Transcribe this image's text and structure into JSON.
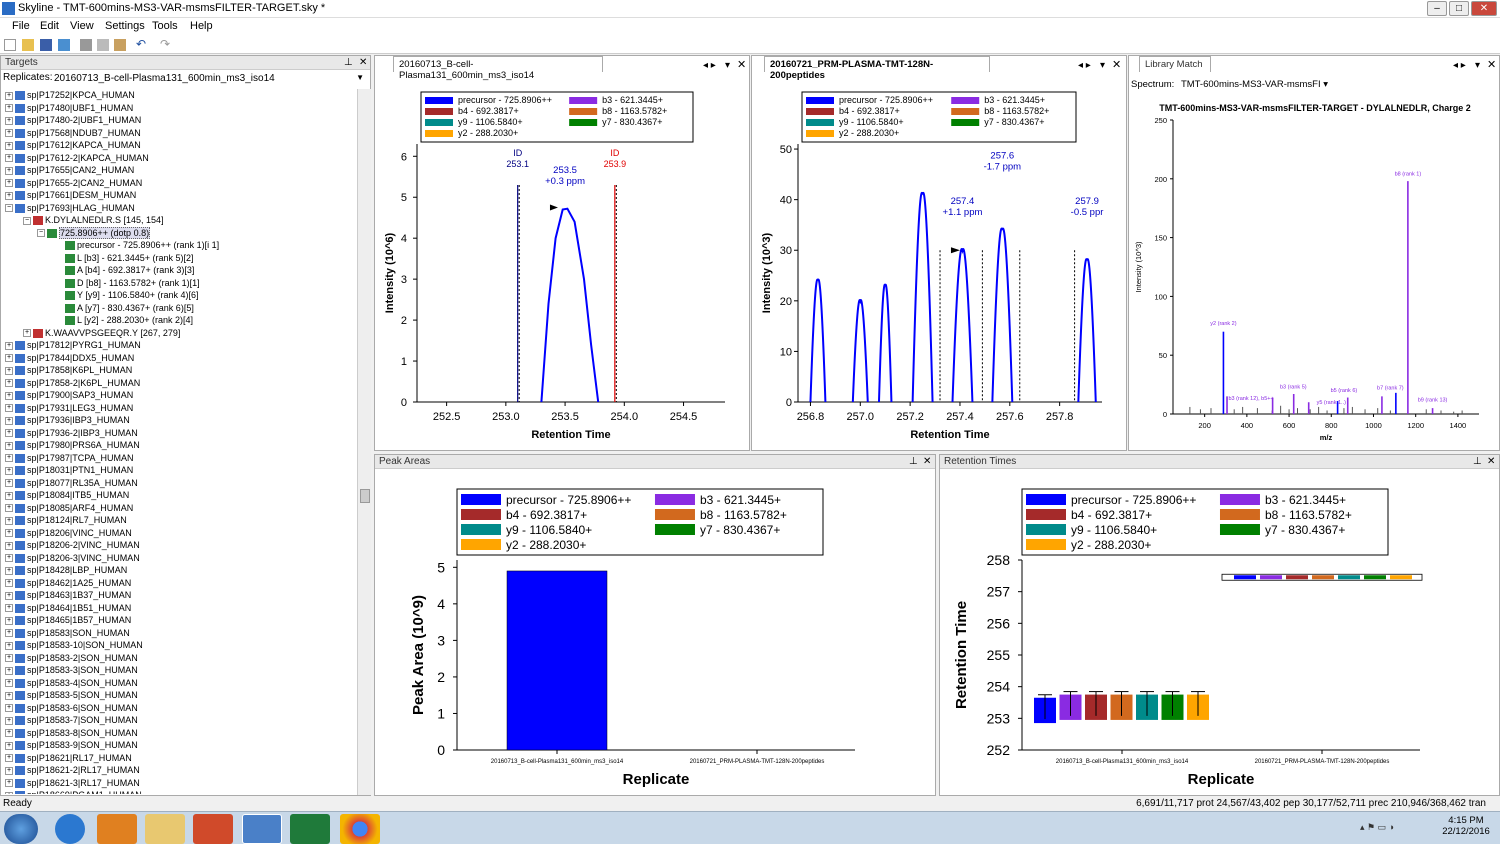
{
  "window": {
    "title": "Skyline - TMT-600mins-MS3-VAR-msmsFILTER-TARGET.sky *"
  },
  "menu": [
    "File",
    "Edit",
    "View",
    "Settings",
    "Tools",
    "Help"
  ],
  "targets": {
    "title": "Targets",
    "replicates_label": "Replicates:",
    "replicate_value": "20160713_B-cell-Plasma131_600min_ms3_iso14",
    "proteins_top": [
      "sp|P17252|KPCA_HUMAN",
      "sp|P17480|UBF1_HUMAN",
      "sp|P17480-2|UBF1_HUMAN",
      "sp|P17568|NDUB7_HUMAN",
      "sp|P17612|KAPCA_HUMAN",
      "sp|P17612-2|KAPCA_HUMAN",
      "sp|P17655|CAN2_HUMAN",
      "sp|P17655-2|CAN2_HUMAN",
      "sp|P17661|DESM_HUMAN",
      "sp|P17693|HLAG_HUMAN"
    ],
    "peptide1": "K.DYLALNEDLR.S [145, 154]",
    "precursor": "725.8906++ (dotp 0.8)",
    "transitions": [
      "precursor - 725.8906++ (rank 1)[i 1]",
      "L [b3] - 621.3445+ (rank 5)[2]",
      "A [b4] - 692.3817+ (rank 3)[3]",
      "D [b8] - 1163.5782+ (rank 1)[1]",
      "Y [y9] - 1106.5840+ (rank 4)[6]",
      "A [y7] - 830.4367+ (rank 6)[5]",
      "L [y2] - 288.2030+ (rank 2)[4]"
    ],
    "peptide2": "K.WAAVVPSGEEQR.Y [267, 279]",
    "proteins_bottom": [
      "sp|P17812|PYRG1_HUMAN",
      "sp|P17844|DDX5_HUMAN",
      "sp|P17858|K6PL_HUMAN",
      "sp|P17858-2|K6PL_HUMAN",
      "sp|P17900|SAP3_HUMAN",
      "sp|P17931|LEG3_HUMAN",
      "sp|P17936|IBP3_HUMAN",
      "sp|P17936-2|IBP3_HUMAN",
      "sp|P17980|PRS6A_HUMAN",
      "sp|P17987|TCPA_HUMAN",
      "sp|P18031|PTN1_HUMAN",
      "sp|P18077|RL35A_HUMAN",
      "sp|P18084|ITB5_HUMAN",
      "sp|P18085|ARF4_HUMAN",
      "sp|P18124|RL7_HUMAN",
      "sp|P18206|VINC_HUMAN",
      "sp|P18206-2|VINC_HUMAN",
      "sp|P18206-3|VINC_HUMAN",
      "sp|P18428|LBP_HUMAN",
      "sp|P18462|1A25_HUMAN",
      "sp|P18463|1B37_HUMAN",
      "sp|P18464|1B51_HUMAN",
      "sp|P18465|1B57_HUMAN",
      "sp|P18583|SON_HUMAN",
      "sp|P18583-10|SON_HUMAN",
      "sp|P18583-2|SON_HUMAN",
      "sp|P18583-3|SON_HUMAN",
      "sp|P18583-4|SON_HUMAN",
      "sp|P18583-5|SON_HUMAN",
      "sp|P18583-6|SON_HUMAN",
      "sp|P18583-7|SON_HUMAN",
      "sp|P18583-8|SON_HUMAN",
      "sp|P18583-9|SON_HUMAN",
      "sp|P18621|RL17_HUMAN",
      "sp|P18621-2|RL17_HUMAN",
      "sp|P18621-3|RL17_HUMAN",
      "sp|P18669|PGAM1_HUMAN"
    ]
  },
  "colors": {
    "precursor": "#0000ff",
    "b3": "#8a2be2",
    "b4": "#a52a2a",
    "b8": "#d2691e",
    "y9": "#008b8b",
    "y7": "#008000",
    "y2": "#ffa500"
  },
  "legend": [
    {
      "key": "precursor",
      "label": "precursor - 725.8906++"
    },
    {
      "key": "b3",
      "label": "b3 - 621.3445+"
    },
    {
      "key": "b4",
      "label": "b4 - 692.3817+"
    },
    {
      "key": "b8",
      "label": "b8 - 1163.5782+"
    },
    {
      "key": "y9",
      "label": "y9 - 1106.5840+"
    },
    {
      "key": "y7",
      "label": "y7 - 830.4367+"
    },
    {
      "key": "y2",
      "label": "y2 - 288.2030+"
    }
  ],
  "chrom1": {
    "tab": "20160713_B-cell-Plasma131_600min_ms3_iso14",
    "ylabel": "Intensity (10^6)",
    "xlabel": "Retention Time",
    "yticks": [
      "0",
      "1",
      "2",
      "3",
      "4",
      "5",
      "6"
    ],
    "xticks": [
      "252.5",
      "253.0",
      "253.5",
      "254.0",
      "254.5"
    ],
    "id_left": {
      "label": "ID",
      "value": "253.1"
    },
    "id_right": {
      "label": "ID",
      "value": "253.9"
    },
    "peak": {
      "rt": "253.5",
      "ppm": "+0.3 ppm"
    }
  },
  "chrom2": {
    "tab": "20160721_PRM-PLASMA-TMT-128N-200peptides",
    "ylabel": "Intensity (10^3)",
    "xlabel": "Retention Time",
    "yticks": [
      "0",
      "10",
      "20",
      "30",
      "40",
      "50"
    ],
    "xticks": [
      "256.8",
      "257.0",
      "257.2",
      "257.4",
      "257.6",
      "257.8"
    ],
    "peaks": [
      {
        "rt": "257.4",
        "ppm": "+1.1 ppm"
      },
      {
        "rt": "257.6",
        "ppm": "-1.7 ppm"
      },
      {
        "rt": "257.9",
        "ppm": "-0.5 ppr"
      }
    ]
  },
  "library": {
    "tab": "Library Match",
    "spectrum_label": "Spectrum:",
    "spectrum_value": "TMT-600mins-MS3-VAR-msmsFI",
    "title": "TMT-600mins-MS3-VAR-msmsFILTER-TARGET - DYLALNEDLR, Charge 2",
    "ylabel": "Intensity (10^3)",
    "xlabel": "m/z",
    "yticks": [
      "0",
      "50",
      "100",
      "150",
      "200",
      "250"
    ],
    "xticks": [
      "200",
      "400",
      "600",
      "800",
      "1000",
      "1200",
      "1400"
    ],
    "annotations": [
      "b8 (rank 1)",
      "y2 (rank 2)",
      "b3 (rank 5)",
      "b5 (rank 6)",
      "b7 (rank 7)",
      "b3 (rank 12), b5++",
      "y5 (rank 1..)",
      "b9 (rank 13)"
    ]
  },
  "peak_areas": {
    "title": "Peak Areas",
    "ylabel": "Peak Area (10^9)",
    "xlabel": "Replicate",
    "yticks": [
      "0",
      "1",
      "2",
      "3",
      "4",
      "5"
    ],
    "categories": [
      "20160713_B-cell-Plasma131_600min_ms3_iso14",
      "20160721_PRM-PLASMA-TMT-128N-200peptides"
    ]
  },
  "retention_times": {
    "title": "Retention Times",
    "ylabel": "Retention Time",
    "xlabel": "Replicate",
    "yticks": [
      "252",
      "253",
      "254",
      "255",
      "256",
      "257",
      "258"
    ],
    "categories": [
      "20160713_B-cell-Plasma131_600min_ms3_iso14",
      "20160721_PRM-PLASMA-TMT-128N-200peptides"
    ]
  },
  "chart_data": [
    {
      "type": "bar",
      "title": "Peak Areas",
      "xlabel": "Replicate",
      "ylabel": "Peak Area (10^9)",
      "ylim": [
        0,
        5.2
      ],
      "categories": [
        "20160713_B-cell-Plasma131_600min_ms3_iso14",
        "20160721_PRM-PLASMA-TMT-128N-200peptides"
      ],
      "series": [
        {
          "name": "precursor - 725.8906++",
          "values": [
            4.9,
            0
          ]
        }
      ]
    },
    {
      "type": "bar",
      "title": "Retention Times",
      "xlabel": "Replicate",
      "ylabel": "Retention Time",
      "ylim": [
        252,
        258
      ],
      "categories": [
        "20160713_B-cell-Plasma131_600min_ms3_iso14",
        "20160721_PRM-PLASMA-TMT-128N-200peptides"
      ],
      "series": [
        {
          "name": "precursor - 725.8906++",
          "values": [
            253.5,
            257.5
          ]
        },
        {
          "name": "b3 - 621.3445+",
          "values": [
            253.6,
            257.5
          ]
        },
        {
          "name": "b4 - 692.3817+",
          "values": [
            253.6,
            257.5
          ]
        },
        {
          "name": "b8 - 1163.5782+",
          "values": [
            253.6,
            257.5
          ]
        },
        {
          "name": "y9 - 1106.5840+",
          "values": [
            253.6,
            257.5
          ]
        },
        {
          "name": "y7 - 830.4367+",
          "values": [
            253.6,
            257.5
          ]
        },
        {
          "name": "y2 - 288.2030+",
          "values": [
            253.6,
            257.5
          ]
        }
      ]
    }
  ],
  "status": {
    "left": "Ready",
    "right": "6,691/11,717 prot   24,567/43,402 pep   30,177/52,711 prec   210,946/368,462 tran"
  },
  "clock": {
    "time": "4:15 PM",
    "date": "22/12/2016"
  }
}
